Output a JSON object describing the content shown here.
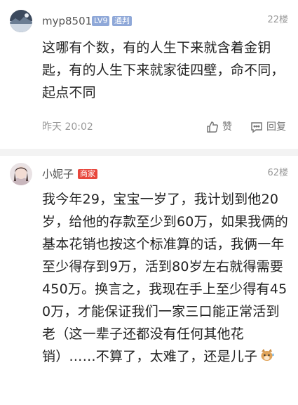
{
  "comments": [
    {
      "username": "myp8501",
      "level_badge": "LV9",
      "level_color": "#8fa8d8",
      "role_badge": "通判",
      "role_color": "#8fa8d8",
      "floor": "22楼",
      "content": "这哪有个数，有的人生下来就含着金钥匙，有的人生下来就家徒四壁，命不同，起点不同",
      "time": "昨天 20:02",
      "like_label": "赞",
      "reply_label": "回复"
    },
    {
      "username": "小妮子",
      "role_badge": "商家",
      "role_color": "#e8463c",
      "floor": "62楼",
      "content": "我今年29，宝宝一岁了，我计划到他20岁，给他的存款至少到60万，如果我俩的基本花销也按这个标准算的话，我俩一年至少得存到9万，活到80岁左右就得需要450万。换言之，我现在手上至少得有450万，才能保证我们一家三口能正常活到老（这一辈子还都没有任何其他花销）……不算了，太难了，还是儿子",
      "emoji": "cat-sweat-emoji"
    }
  ]
}
